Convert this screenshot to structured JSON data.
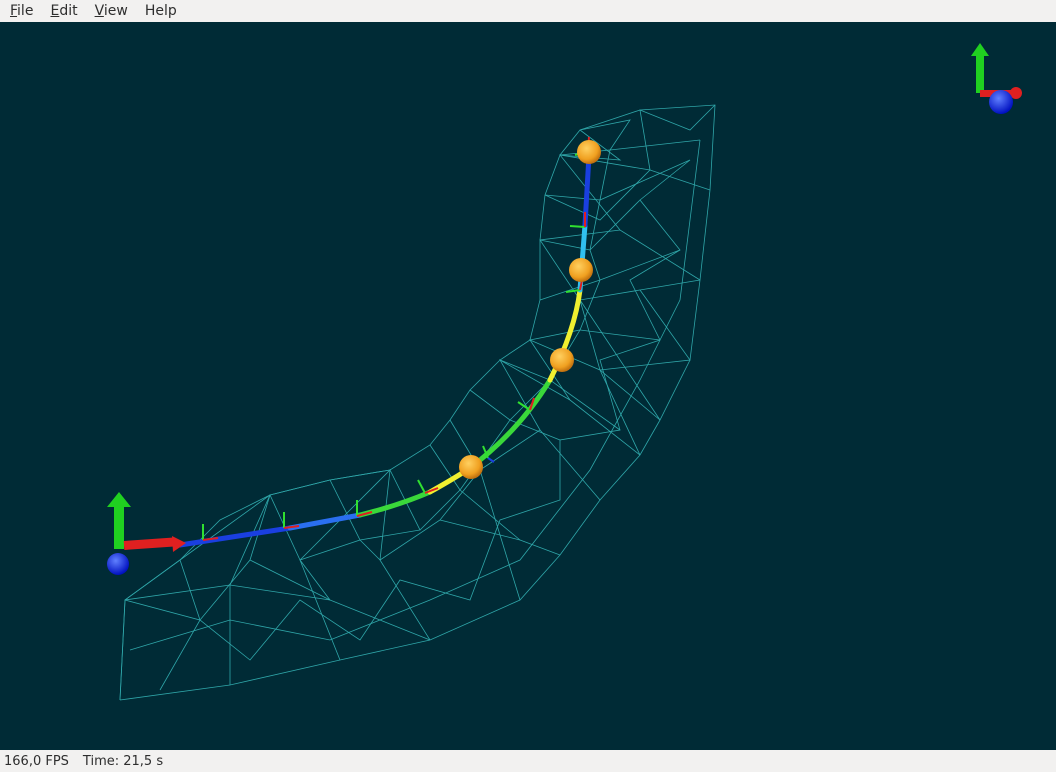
{
  "menu": {
    "items": [
      {
        "mnemonic": "F",
        "rest": "ile"
      },
      {
        "mnemonic": "E",
        "rest": "dit"
      },
      {
        "mnemonic": "V",
        "rest": "iew"
      },
      {
        "mnemonic": "",
        "rest": "Help"
      }
    ]
  },
  "viewport": {
    "background": "#002b36",
    "mesh_color": "#3fd0d0",
    "sphere_color": "#f0a020"
  },
  "status": {
    "fps": "166,0 FPS",
    "time": "Time: 21,5 s"
  }
}
